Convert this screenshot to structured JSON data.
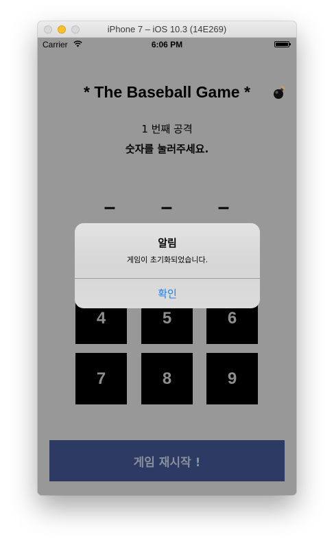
{
  "window": {
    "title": "iPhone 7 – iOS 10.3 (14E269)"
  },
  "status_bar": {
    "carrier": "Carrier",
    "time": "6:06 PM",
    "icons": [
      "wifi-icon",
      "battery-icon"
    ]
  },
  "game": {
    "title": "* The Baseball Game *",
    "title_icon": "bomb-icon",
    "round_text": "1 번째 공격",
    "prompt_text": "숫자를 눌러주세요.",
    "digit_slots": [
      "–",
      "–",
      "–"
    ],
    "keypad_rows": [
      [
        "4",
        "5",
        "6"
      ],
      [
        "7",
        "8",
        "9"
      ]
    ],
    "restart_label": "게임 재시작 !"
  },
  "alert": {
    "title": "알림",
    "message": "게임이 초기화되었습니다.",
    "confirm_label": "확인"
  },
  "colors": {
    "screen_background": "#989898",
    "keypad_key": "#000000",
    "restart_button": "#2d3a63",
    "alert_button_text": "#1a7ff5"
  }
}
